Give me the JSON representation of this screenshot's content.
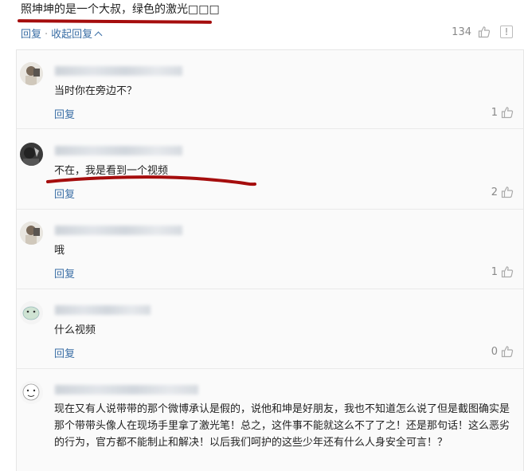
{
  "top_comment": {
    "text": "照坤坤的是一个大叔，绿色的激光□□□",
    "actions": {
      "reply": "回复",
      "separator": "·",
      "collapse": "收起回复"
    },
    "like_count": "134"
  },
  "replies": [
    {
      "text": "当时你在旁边不？",
      "reply_label": "回复",
      "likes": "1"
    },
    {
      "text": "不在，我是看到一个视频",
      "reply_label": "回复",
      "likes": "2"
    },
    {
      "text": "哦",
      "reply_label": "回复",
      "likes": "1"
    },
    {
      "text": "什么视频",
      "reply_label": "回复",
      "likes": "0"
    },
    {
      "text": "现在又有人说带带的那个微博承认是假的，说他和坤是好朋友，我也不知道怎么说了但是截图确实是那个带带头像人在现场手里拿了激光笔！总之，这件事不能就这么不了了之！还是那句话！这么恶劣的行为，官方都不能制止和解决！以后我们呵护的这些少年还有什么人身安全可言！？",
      "reply_label": "",
      "likes": ""
    }
  ],
  "colors": {
    "link": "#3a6ea5",
    "annotation": "#a50d0d",
    "text": "#222222",
    "muted": "#888888"
  },
  "icons": [
    "thumbs-up-icon",
    "report-icon",
    "chevron-up-icon",
    "avatar"
  ]
}
